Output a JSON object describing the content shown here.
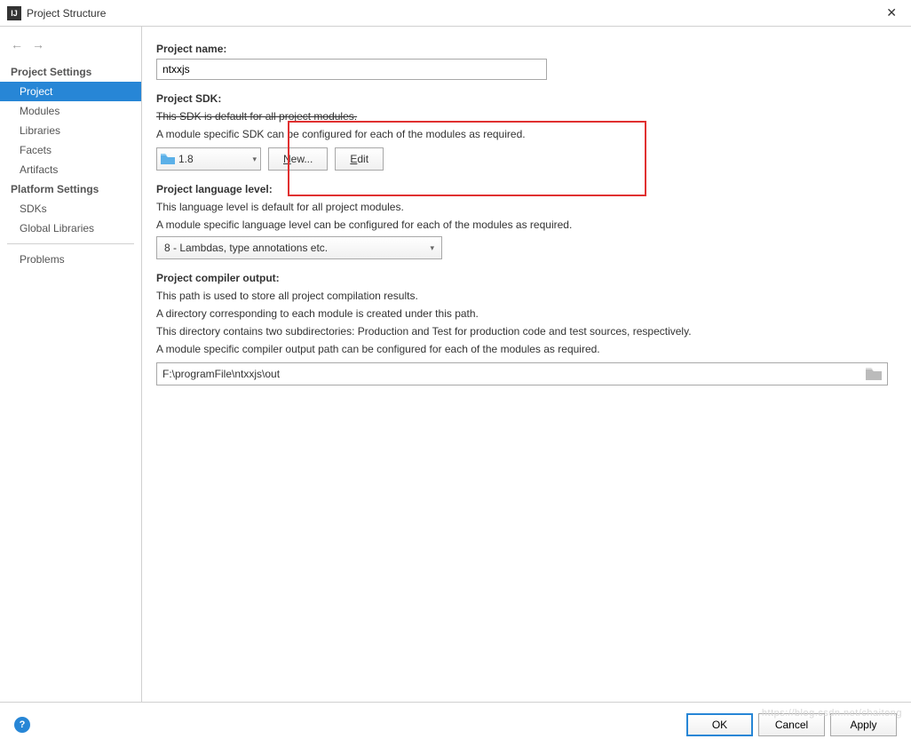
{
  "window": {
    "title": "Project Structure"
  },
  "nav": {
    "back": "←",
    "forward": "→"
  },
  "sidebar": {
    "section1": "Project Settings",
    "items1": [
      "Project",
      "Modules",
      "Libraries",
      "Facets",
      "Artifacts"
    ],
    "section2": "Platform Settings",
    "items2": [
      "SDKs",
      "Global Libraries"
    ],
    "problems": "Problems"
  },
  "main": {
    "projectNameLabel": "Project name:",
    "projectNameValue": "ntxxjs",
    "sdkLabel": "Project SDK:",
    "sdkDesc1": "This SDK is default for all project modules.",
    "sdkDesc2": "A module specific SDK can be configured for each of the modules as required.",
    "sdkValue": "1.8",
    "newBtnPrefix": "N",
    "newBtnRest": "ew...",
    "editBtnPrefix": "E",
    "editBtnRest": "dit",
    "langLabel": "Project language level:",
    "langDesc1": "This language level is default for all project modules.",
    "langDesc2": "A module specific language level can be configured for each of the modules as required.",
    "langValue": "8 - Lambdas, type annotations etc.",
    "outLabel": "Project compiler output:",
    "outDesc1": "This path is used to store all project compilation results.",
    "outDesc2": "A directory corresponding to each module is created under this path.",
    "outDesc3": "This directory contains two subdirectories: Production and Test for production code and test sources, respectively.",
    "outDesc4": "A module specific compiler output path can be configured for each of the modules as required.",
    "outValue": "F:\\programFile\\ntxxjs\\out"
  },
  "footer": {
    "ok": "OK",
    "cancel": "Cancel",
    "apply": "Apply"
  },
  "watermark": "https://blog.csdn.net/chaitong"
}
